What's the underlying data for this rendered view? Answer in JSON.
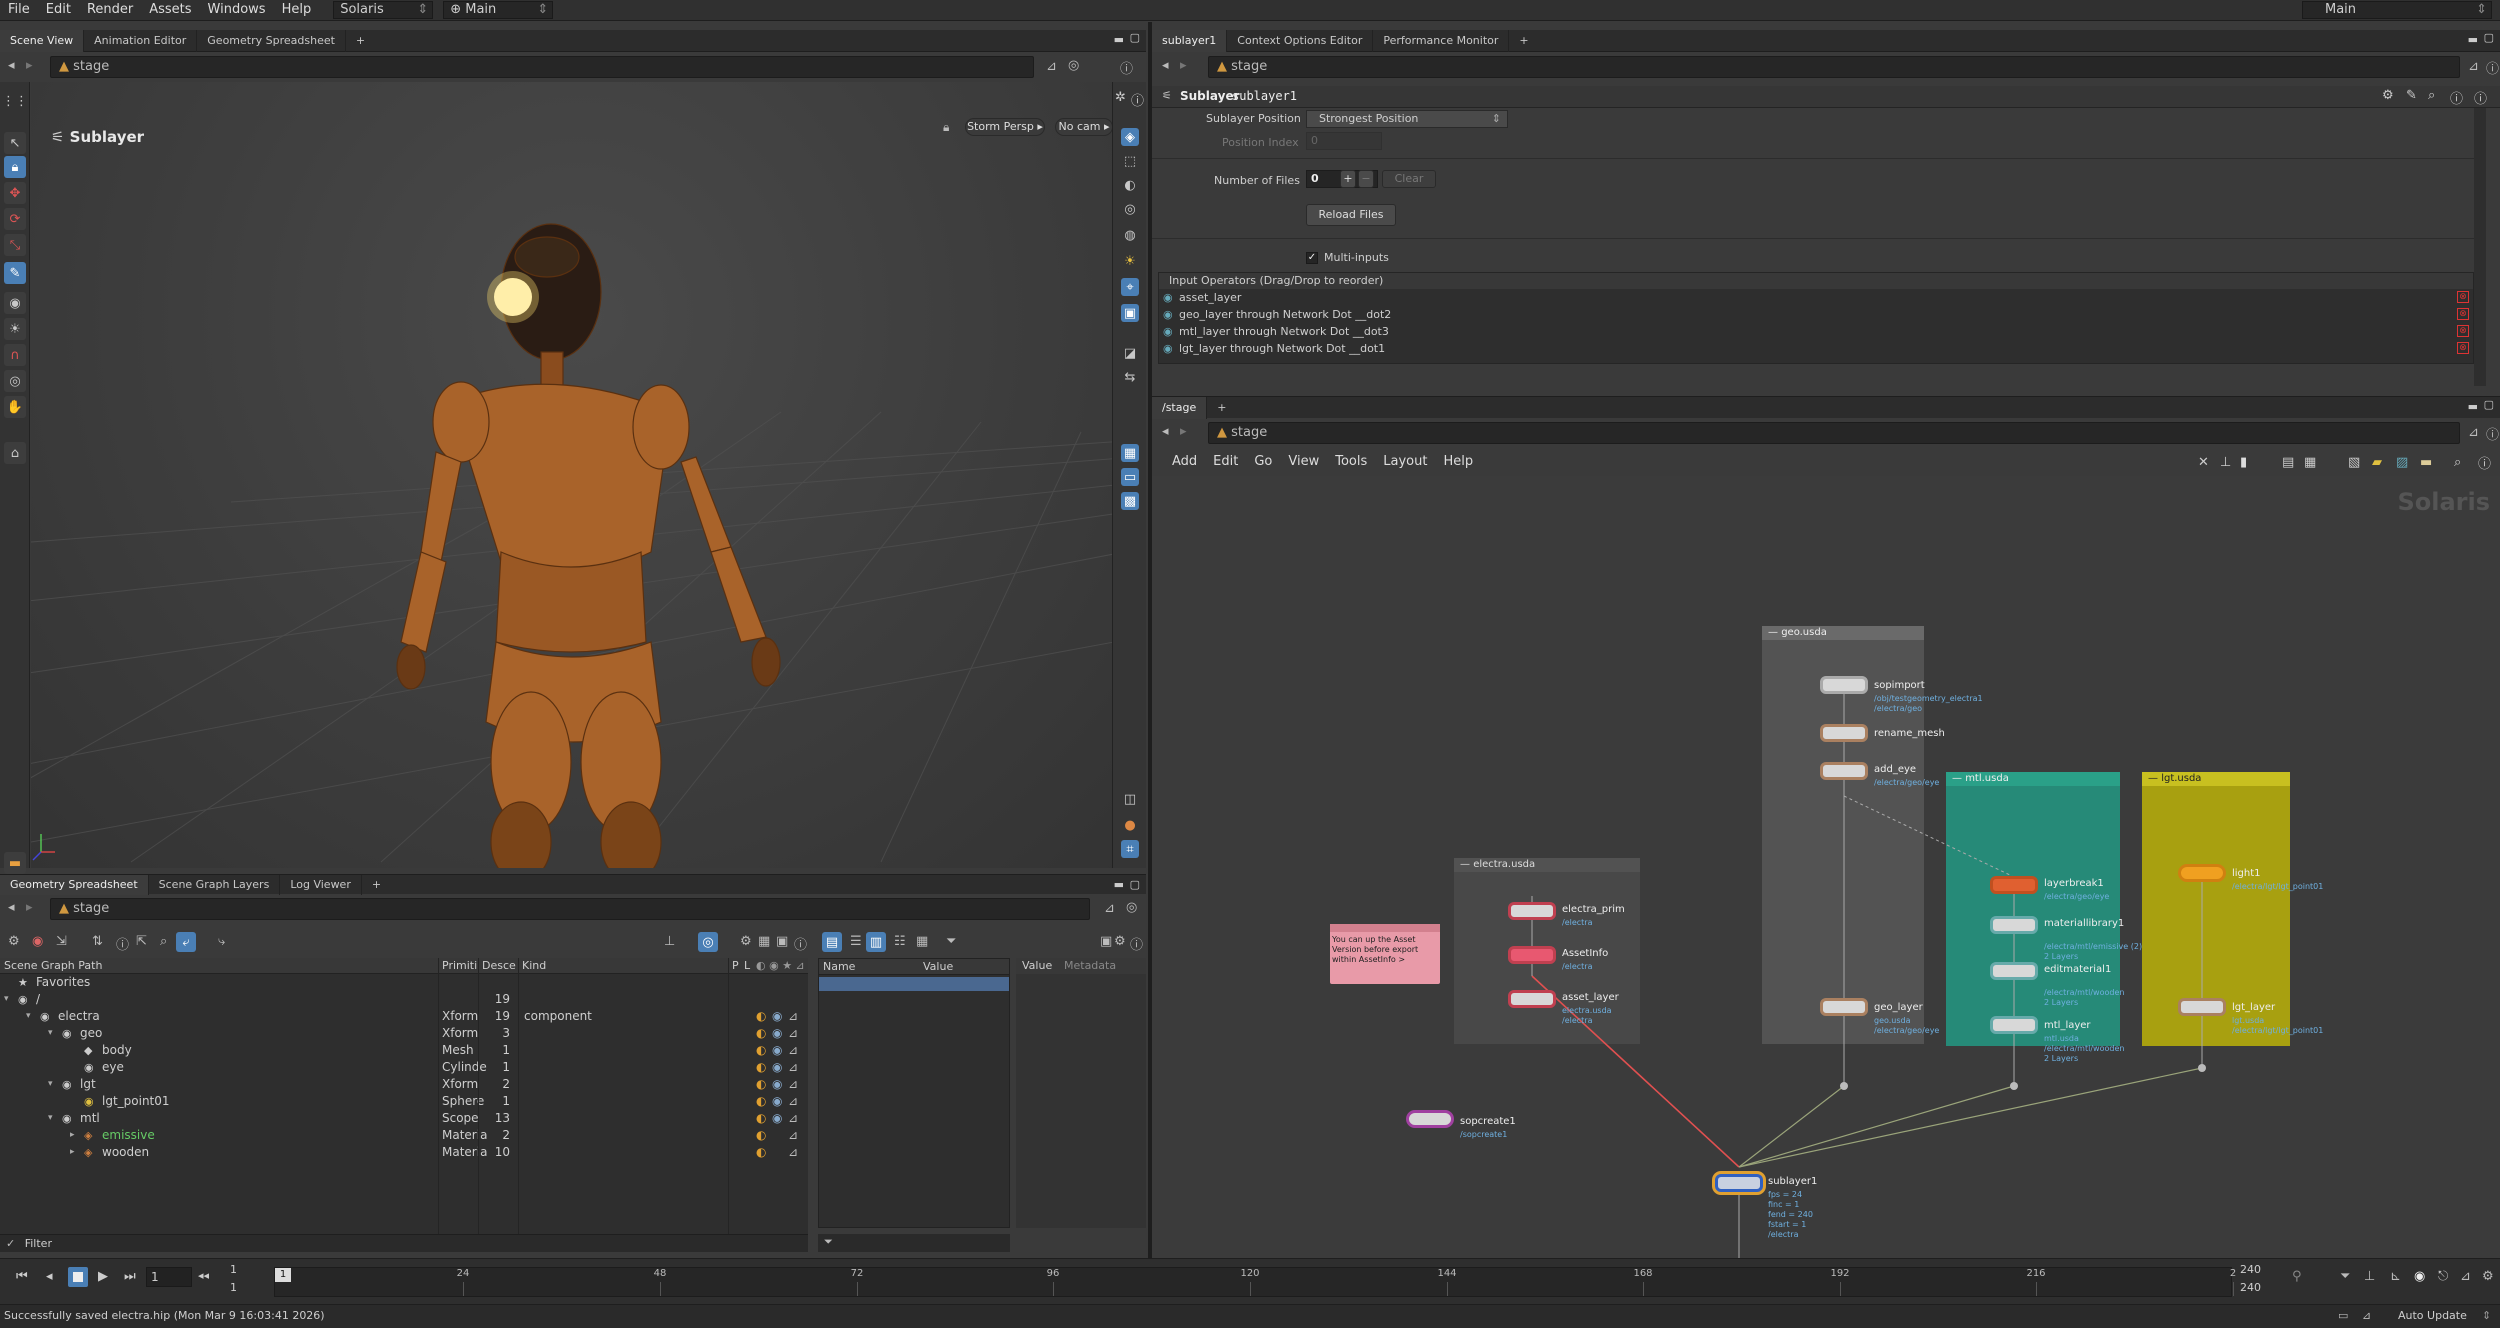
{
  "menubar": {
    "items": [
      "File",
      "Edit",
      "Render",
      "Assets",
      "Windows",
      "Help"
    ],
    "desktop": "Solaris",
    "context": "Main",
    "right_context": "Main"
  },
  "left_top_tabs": [
    "Scene View",
    "Animation Editor",
    "Geometry Spreadsheet"
  ],
  "right_top_tabs": [
    "sublayer1",
    "Context Options Editor",
    "Performance Monitor"
  ],
  "left_path": "stage",
  "viewport": {
    "title": "Sublayer",
    "camera_menu": "Storm Persp",
    "nocam_menu": "No cam"
  },
  "params": {
    "node_type": "Sublayer",
    "node_name": "sublayer1",
    "path": "stage",
    "sublayer_position_label": "Sublayer Position",
    "sublayer_position_value": "Strongest Position",
    "position_index_label": "Position Index",
    "position_index_value": "0",
    "num_files_label": "Number of Files",
    "num_files_value": "0",
    "clear_label": "Clear",
    "reload_label": "Reload Files",
    "multi_inputs_label": "Multi-inputs",
    "input_ops_header": "Input Operators (Drag/Drop to reorder)",
    "inputs": [
      "asset_layer",
      "geo_layer through Network Dot __dot2",
      "mtl_layer through Network Dot __dot3",
      "lgt_layer through Network Dot __dot1"
    ]
  },
  "network": {
    "tab": "/stage",
    "path": "stage",
    "menu": [
      "Add",
      "Edit",
      "Go",
      "View",
      "Tools",
      "Layout",
      "Help"
    ],
    "watermark": "Solaris",
    "boxes": {
      "electra": "electra.usda",
      "geo": "geo.usda",
      "mtl": "mtl.usda",
      "lgt": "lgt.usda"
    },
    "sticky_note": "You can up the Asset Version before export within AssetInfo >",
    "nodes": {
      "electra_prim": {
        "name": "electra_prim",
        "sub": "/electra"
      },
      "assetinfo": {
        "name": "AssetInfo",
        "sub": "/electra"
      },
      "asset_layer": {
        "name": "asset_layer",
        "sub": "electra.usda\n/electra"
      },
      "sopimport": {
        "name": "sopimport",
        "sub": "/obj/testgeometry_electra1\n/electra/geo"
      },
      "rename_mesh": {
        "name": "rename_mesh",
        "sub": ""
      },
      "add_eye": {
        "name": "add_eye",
        "sub": "/electra/geo/eye"
      },
      "geo_layer": {
        "name": "geo_layer",
        "sub": "geo.usda\n/electra/geo/eye"
      },
      "layerbreak1": {
        "name": "layerbreak1",
        "sub": "/electra/geo/eye"
      },
      "materiallibrary1": {
        "name": "materiallibrary1",
        "sub": "/electra/mtl/emissive (2)\n2 Layers"
      },
      "editmaterial1": {
        "name": "editmaterial1",
        "sub": "/electra/mtl/wooden\n2 Layers"
      },
      "mtl_layer": {
        "name": "mtl_layer",
        "sub": "mtl.usda\n/electra/mtl/wooden\n2 Layers"
      },
      "light1": {
        "name": "light1",
        "sub": "/electra/lgt/lgt_point01"
      },
      "lgt_layer": {
        "name": "lgt_layer",
        "sub": "lgt.usda\n/electra/lgt/lgt_point01"
      },
      "sopcreate1": {
        "name": "sopcreate1",
        "sub": "/sopcreate1"
      },
      "sublayer1": {
        "name": "sublayer1",
        "sub": "fps = 24\nfinc = 1\nfend = 240\nfstart = 1\n/electra"
      }
    }
  },
  "bottom_tabs": [
    "Geometry Spreadsheet",
    "Scene Graph Layers",
    "Log Viewer"
  ],
  "scene_graph": {
    "path": "stage",
    "columns": [
      "Scene Graph Path",
      "Primiti",
      "Desce",
      "Kind"
    ],
    "flag_cols": [
      "P",
      "L"
    ],
    "rows": [
      {
        "name": "Favorites",
        "type": "",
        "desc": "",
        "kind": "",
        "indent": 1
      },
      {
        "name": "/",
        "type": "",
        "desc": "19",
        "kind": "",
        "indent": 1
      },
      {
        "name": "electra",
        "type": "Xform",
        "desc": "19",
        "kind": "component",
        "indent": 2
      },
      {
        "name": "geo",
        "type": "Xform",
        "desc": "3",
        "kind": "",
        "indent": 3
      },
      {
        "name": "body",
        "type": "Mesh",
        "desc": "1",
        "kind": "",
        "indent": 4
      },
      {
        "name": "eye",
        "type": "Cylinde",
        "desc": "1",
        "kind": "",
        "indent": 4
      },
      {
        "name": "lgt",
        "type": "Xform",
        "desc": "2",
        "kind": "",
        "indent": 3
      },
      {
        "name": "lgt_point01",
        "type": "Sphere",
        "desc": "1",
        "kind": "",
        "indent": 4
      },
      {
        "name": "mtl",
        "type": "Scope",
        "desc": "13",
        "kind": "",
        "indent": 3
      },
      {
        "name": "emissive",
        "type": "Materia",
        "desc": "2",
        "kind": "",
        "indent": 4
      },
      {
        "name": "wooden",
        "type": "Materia",
        "desc": "10",
        "kind": "",
        "indent": 4
      }
    ],
    "filter": "Filter",
    "props_cols": [
      "Name",
      "Value"
    ],
    "value_header": "Value",
    "metadata_header": "Metadata"
  },
  "timeline": {
    "current_frame": "1",
    "start": "1",
    "end": "1",
    "ticks": [
      "24",
      "48",
      "72",
      "96",
      "120",
      "144",
      "168",
      "192",
      "216",
      "2"
    ],
    "range_end_top": "240",
    "range_end_bottom": "240",
    "frame_marker": "1"
  },
  "status": {
    "message": "Successfully saved electra.hip (Mon Mar 9 16:03:41 2026)",
    "auto_update": "Auto Update"
  }
}
